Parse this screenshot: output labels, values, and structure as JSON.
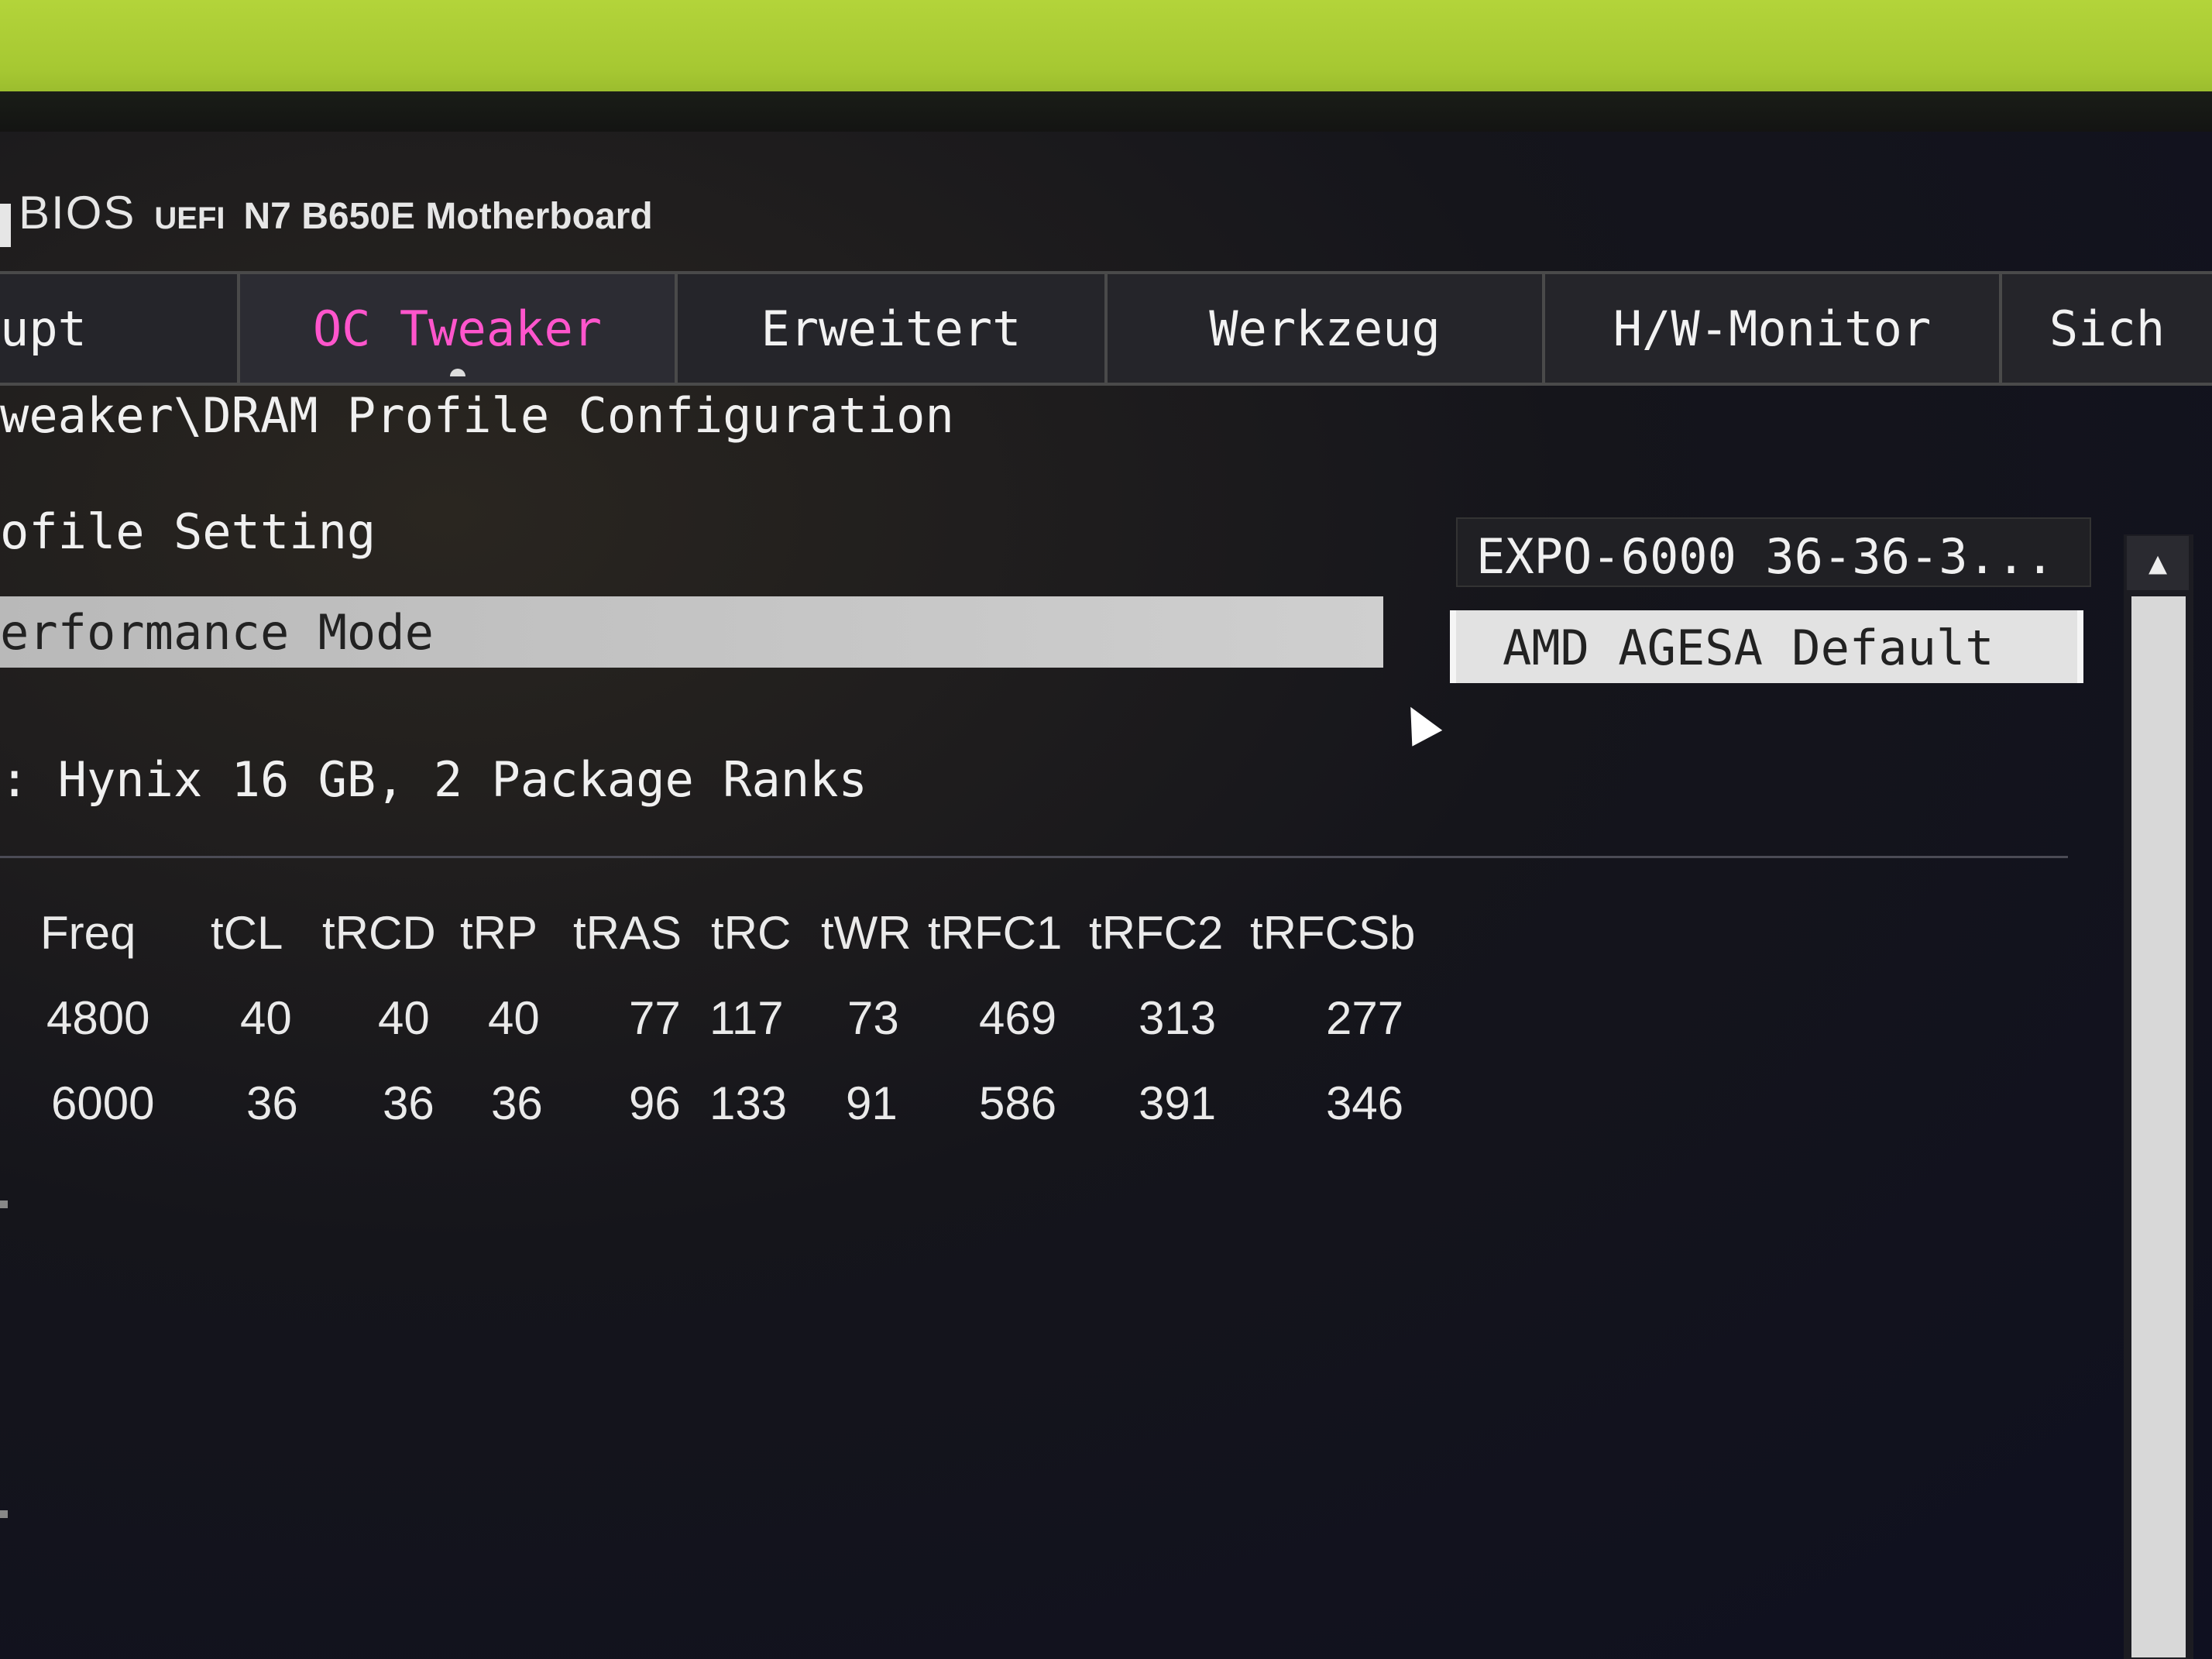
{
  "brand": {
    "bios": "BIOS",
    "uefi": "UEFI",
    "board": "N7 B650E Motherboard"
  },
  "tabs": [
    {
      "label": "upt"
    },
    {
      "label": "OC Tweaker"
    },
    {
      "label": "Erweitert"
    },
    {
      "label": "Werkzeug"
    },
    {
      "label": "H/W-Monitor"
    },
    {
      "label": "Sich"
    }
  ],
  "breadcrumb": "weaker\\DRAM Profile Configuration",
  "settings": {
    "profile_label": "ofile Setting",
    "profile_value": "EXPO-6000 36-36-3...",
    "mode_label": "erformance Mode",
    "mode_value": "AMD AGESA Default"
  },
  "module_info": ": Hynix 16 GB, 2 Package Ranks",
  "scrollbar": {
    "up_arrow": "▲"
  },
  "timing_table": {
    "headers": [
      "Freq",
      "tCL",
      "tRCD",
      "tRP",
      "tRAS",
      "tRC",
      "tWR",
      "tRFC1",
      "tRFC2",
      "tRFCSb"
    ],
    "rows": [
      [
        "4800",
        "40",
        "40",
        "40",
        "77",
        "117",
        "73",
        "469",
        "313",
        "277"
      ],
      [
        "6000",
        "36",
        "36",
        "36",
        "96",
        "133",
        "91",
        "586",
        "391",
        "346"
      ]
    ]
  },
  "colors": {
    "active_tab": "#ff55cc",
    "wall": "#a6c832",
    "screen_bg": "#15151b",
    "highlight_row": "#cfcfcf"
  }
}
